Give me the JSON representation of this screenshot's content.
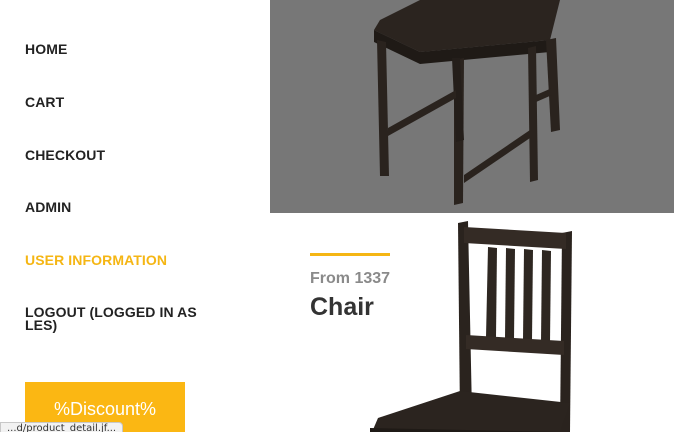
{
  "nav": {
    "items": [
      {
        "label": "HOME",
        "active": false
      },
      {
        "label": "CART",
        "active": false
      },
      {
        "label": "CHECKOUT",
        "active": false
      },
      {
        "label": "ADMIN",
        "active": false
      },
      {
        "label": "USER INFORMATION",
        "active": true
      },
      {
        "label": "LOGOUT (LOGGED IN AS LES)",
        "active": false
      }
    ]
  },
  "discount_button": {
    "label": "%Discount%"
  },
  "status_bar": {
    "text": "...d/product_detail.jf..."
  },
  "product": {
    "price_label": "From 1337",
    "name": "Chair",
    "image_icon": "chair-image"
  },
  "colors": {
    "accent": "#f5b614",
    "button": "#fbb713",
    "overlay": "#777777"
  }
}
